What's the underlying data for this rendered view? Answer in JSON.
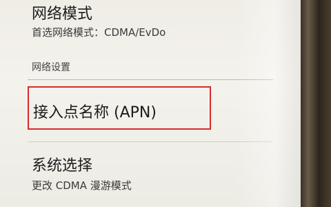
{
  "network_mode": {
    "title": "网络模式",
    "summary": "首选网络模式：CDMA/EvDo"
  },
  "section_header": "网络设置",
  "apn": {
    "title": "接入点名称 (APN)",
    "highlight_color": "#d92a2a"
  },
  "system_select": {
    "title": "系统选择",
    "summary": "更改 CDMA 漫游模式"
  }
}
